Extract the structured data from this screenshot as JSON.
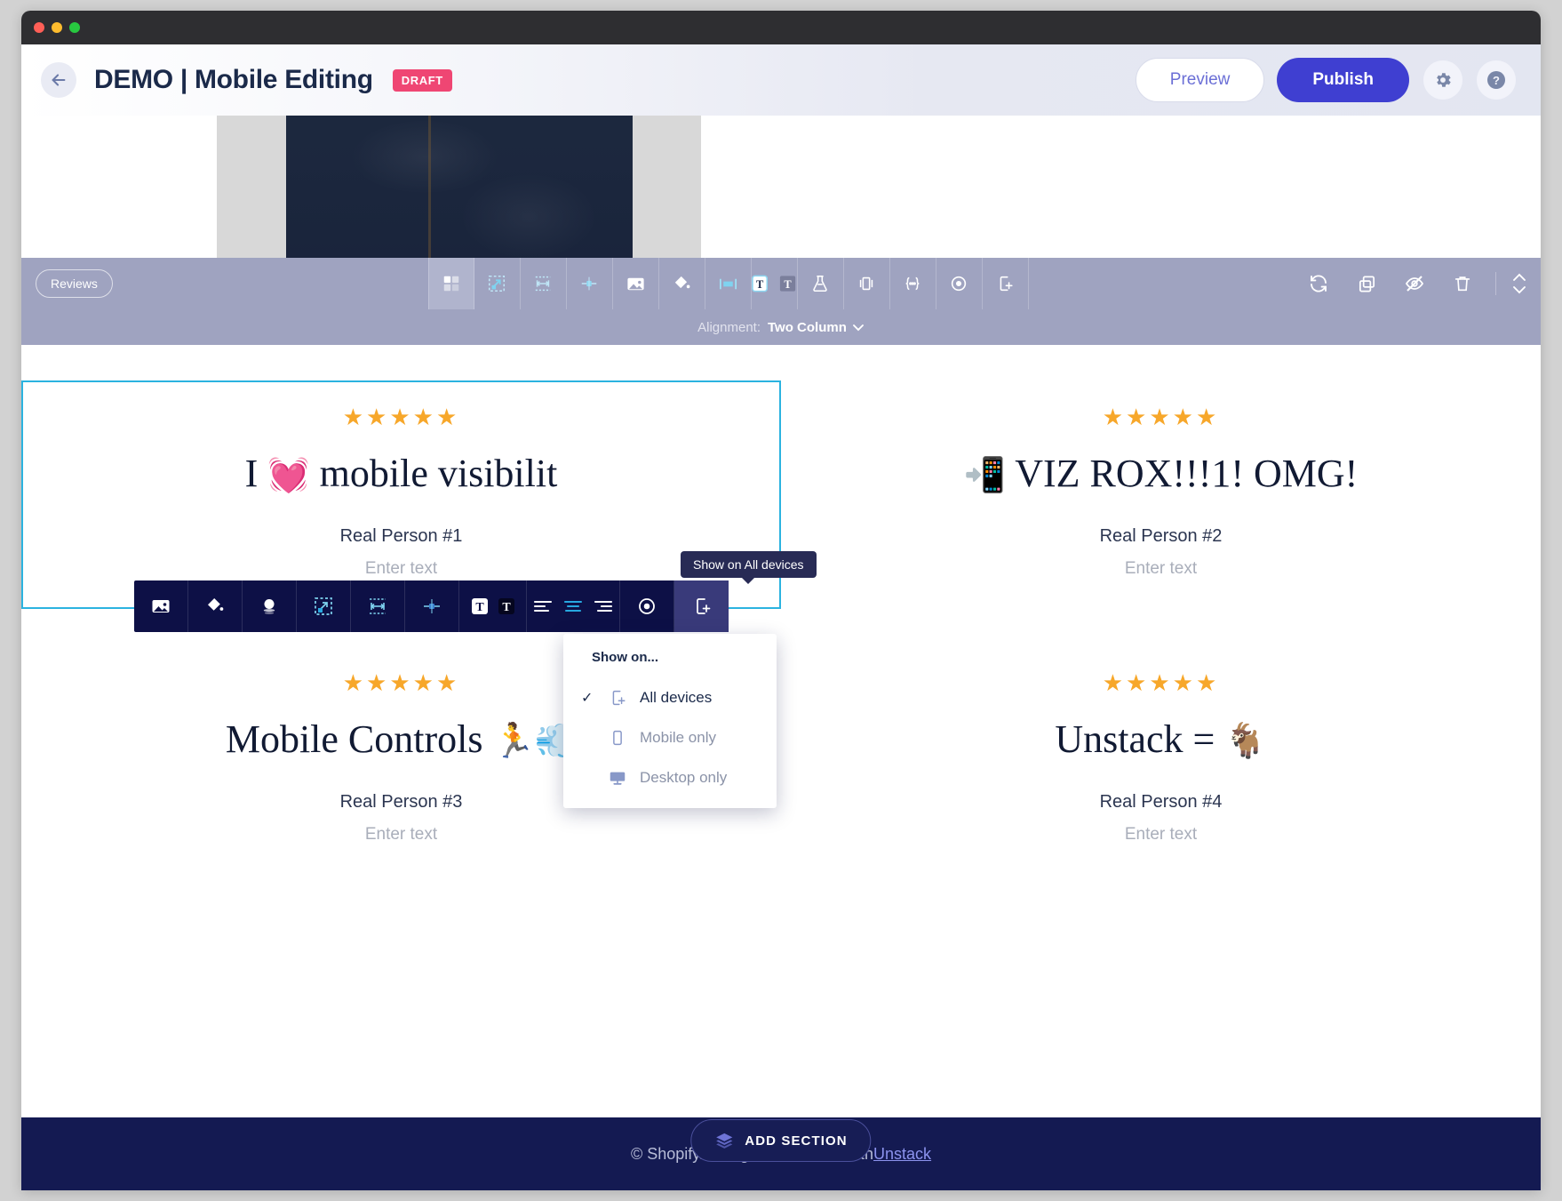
{
  "window": {
    "dots": [
      "close",
      "minimize",
      "maximize"
    ]
  },
  "header": {
    "back_icon": "arrow-left-icon",
    "title": "DEMO | Mobile Editing",
    "badge": "DRAFT",
    "preview_label": "Preview",
    "publish_label": "Publish",
    "settings_icon": "gear-icon",
    "help_icon": "question-mark-icon",
    "accent": "#3f3fd1",
    "badge_color": "#ef4673"
  },
  "section_toolbar": {
    "label": "Reviews",
    "bg": "#9fa3c0",
    "tools": [
      {
        "name": "grid-layout-icon",
        "active": true
      },
      {
        "name": "resize-icon",
        "active": false
      },
      {
        "name": "spacing-icon",
        "active": false
      },
      {
        "name": "divider-icon",
        "active": false
      },
      {
        "name": "image-icon",
        "active": false
      },
      {
        "name": "fill-color-icon",
        "active": false
      },
      {
        "name": "container-width-icon",
        "active": false
      },
      {
        "name": "text-style-icon",
        "active": false
      },
      {
        "name": "experiment-icon",
        "active": false
      },
      {
        "name": "carousel-icon",
        "active": false
      },
      {
        "name": "code-icon",
        "active": false
      },
      {
        "name": "target-icon",
        "active": false
      },
      {
        "name": "device-visibility-icon",
        "active": false
      }
    ],
    "actions": [
      {
        "name": "refresh-icon"
      },
      {
        "name": "duplicate-icon"
      },
      {
        "name": "hide-icon"
      },
      {
        "name": "delete-icon"
      }
    ],
    "move_icon": "move-up-down-icon",
    "alignment_label": "Alignment:",
    "alignment_value": "Two Column"
  },
  "element_toolbar": {
    "bg": "#0d1046",
    "tools": [
      {
        "name": "image-icon"
      },
      {
        "name": "fill-color-icon"
      },
      {
        "name": "shadow-icon"
      },
      {
        "name": "resize-icon"
      },
      {
        "name": "spacing-icon"
      },
      {
        "name": "divider-icon"
      },
      {
        "name": "text-style-icon"
      },
      {
        "name": "text-align-icon"
      },
      {
        "name": "target-icon"
      },
      {
        "name": "device-visibility-icon"
      }
    ]
  },
  "tooltip": {
    "text": "Show on All devices"
  },
  "showon_menu": {
    "title": "Show on...",
    "items": [
      {
        "label": "All devices",
        "icon": "phone-plus-icon",
        "checked": true
      },
      {
        "label": "Mobile only",
        "icon": "phone-icon",
        "checked": false
      },
      {
        "label": "Desktop only",
        "icon": "desktop-icon",
        "checked": false
      }
    ],
    "check_glyph": "✓"
  },
  "reviews": {
    "star_glyph": "★",
    "star_color": "#f7a72a",
    "placeholder": "Enter text",
    "cards": [
      {
        "stars": 5,
        "heading_before": "I ",
        "emoji": "💓",
        "heading_after": " mobile visibilit",
        "author": "Real Person #1",
        "placeholder": "Enter text",
        "selected": true
      },
      {
        "stars": 5,
        "heading_before": "",
        "emoji": "📲",
        "heading_after": " VIZ ROX!!!1! OMG!",
        "author": "Real Person #2",
        "placeholder": "Enter text",
        "selected": false
      },
      {
        "stars": 5,
        "heading_before": "Mobile Controls ",
        "emoji": "🏃💨",
        "heading_after": "",
        "author": "Real Person #3",
        "placeholder": "Enter text",
        "selected": false
      },
      {
        "stars": 5,
        "heading_before": "Unstack = ",
        "emoji": "🐐",
        "heading_after": "",
        "author": "Real Person #4",
        "placeholder": "Enter text",
        "selected": false
      }
    ]
  },
  "footer": {
    "copyright": "© Shopify. Designed and built with Unstack",
    "copyright_pre": "© Shopify. Designed and built with ",
    "link": "Unstack",
    "add_section_label": "ADD SECTION",
    "add_section_icon": "layers-icon",
    "bg": "#141a52"
  }
}
